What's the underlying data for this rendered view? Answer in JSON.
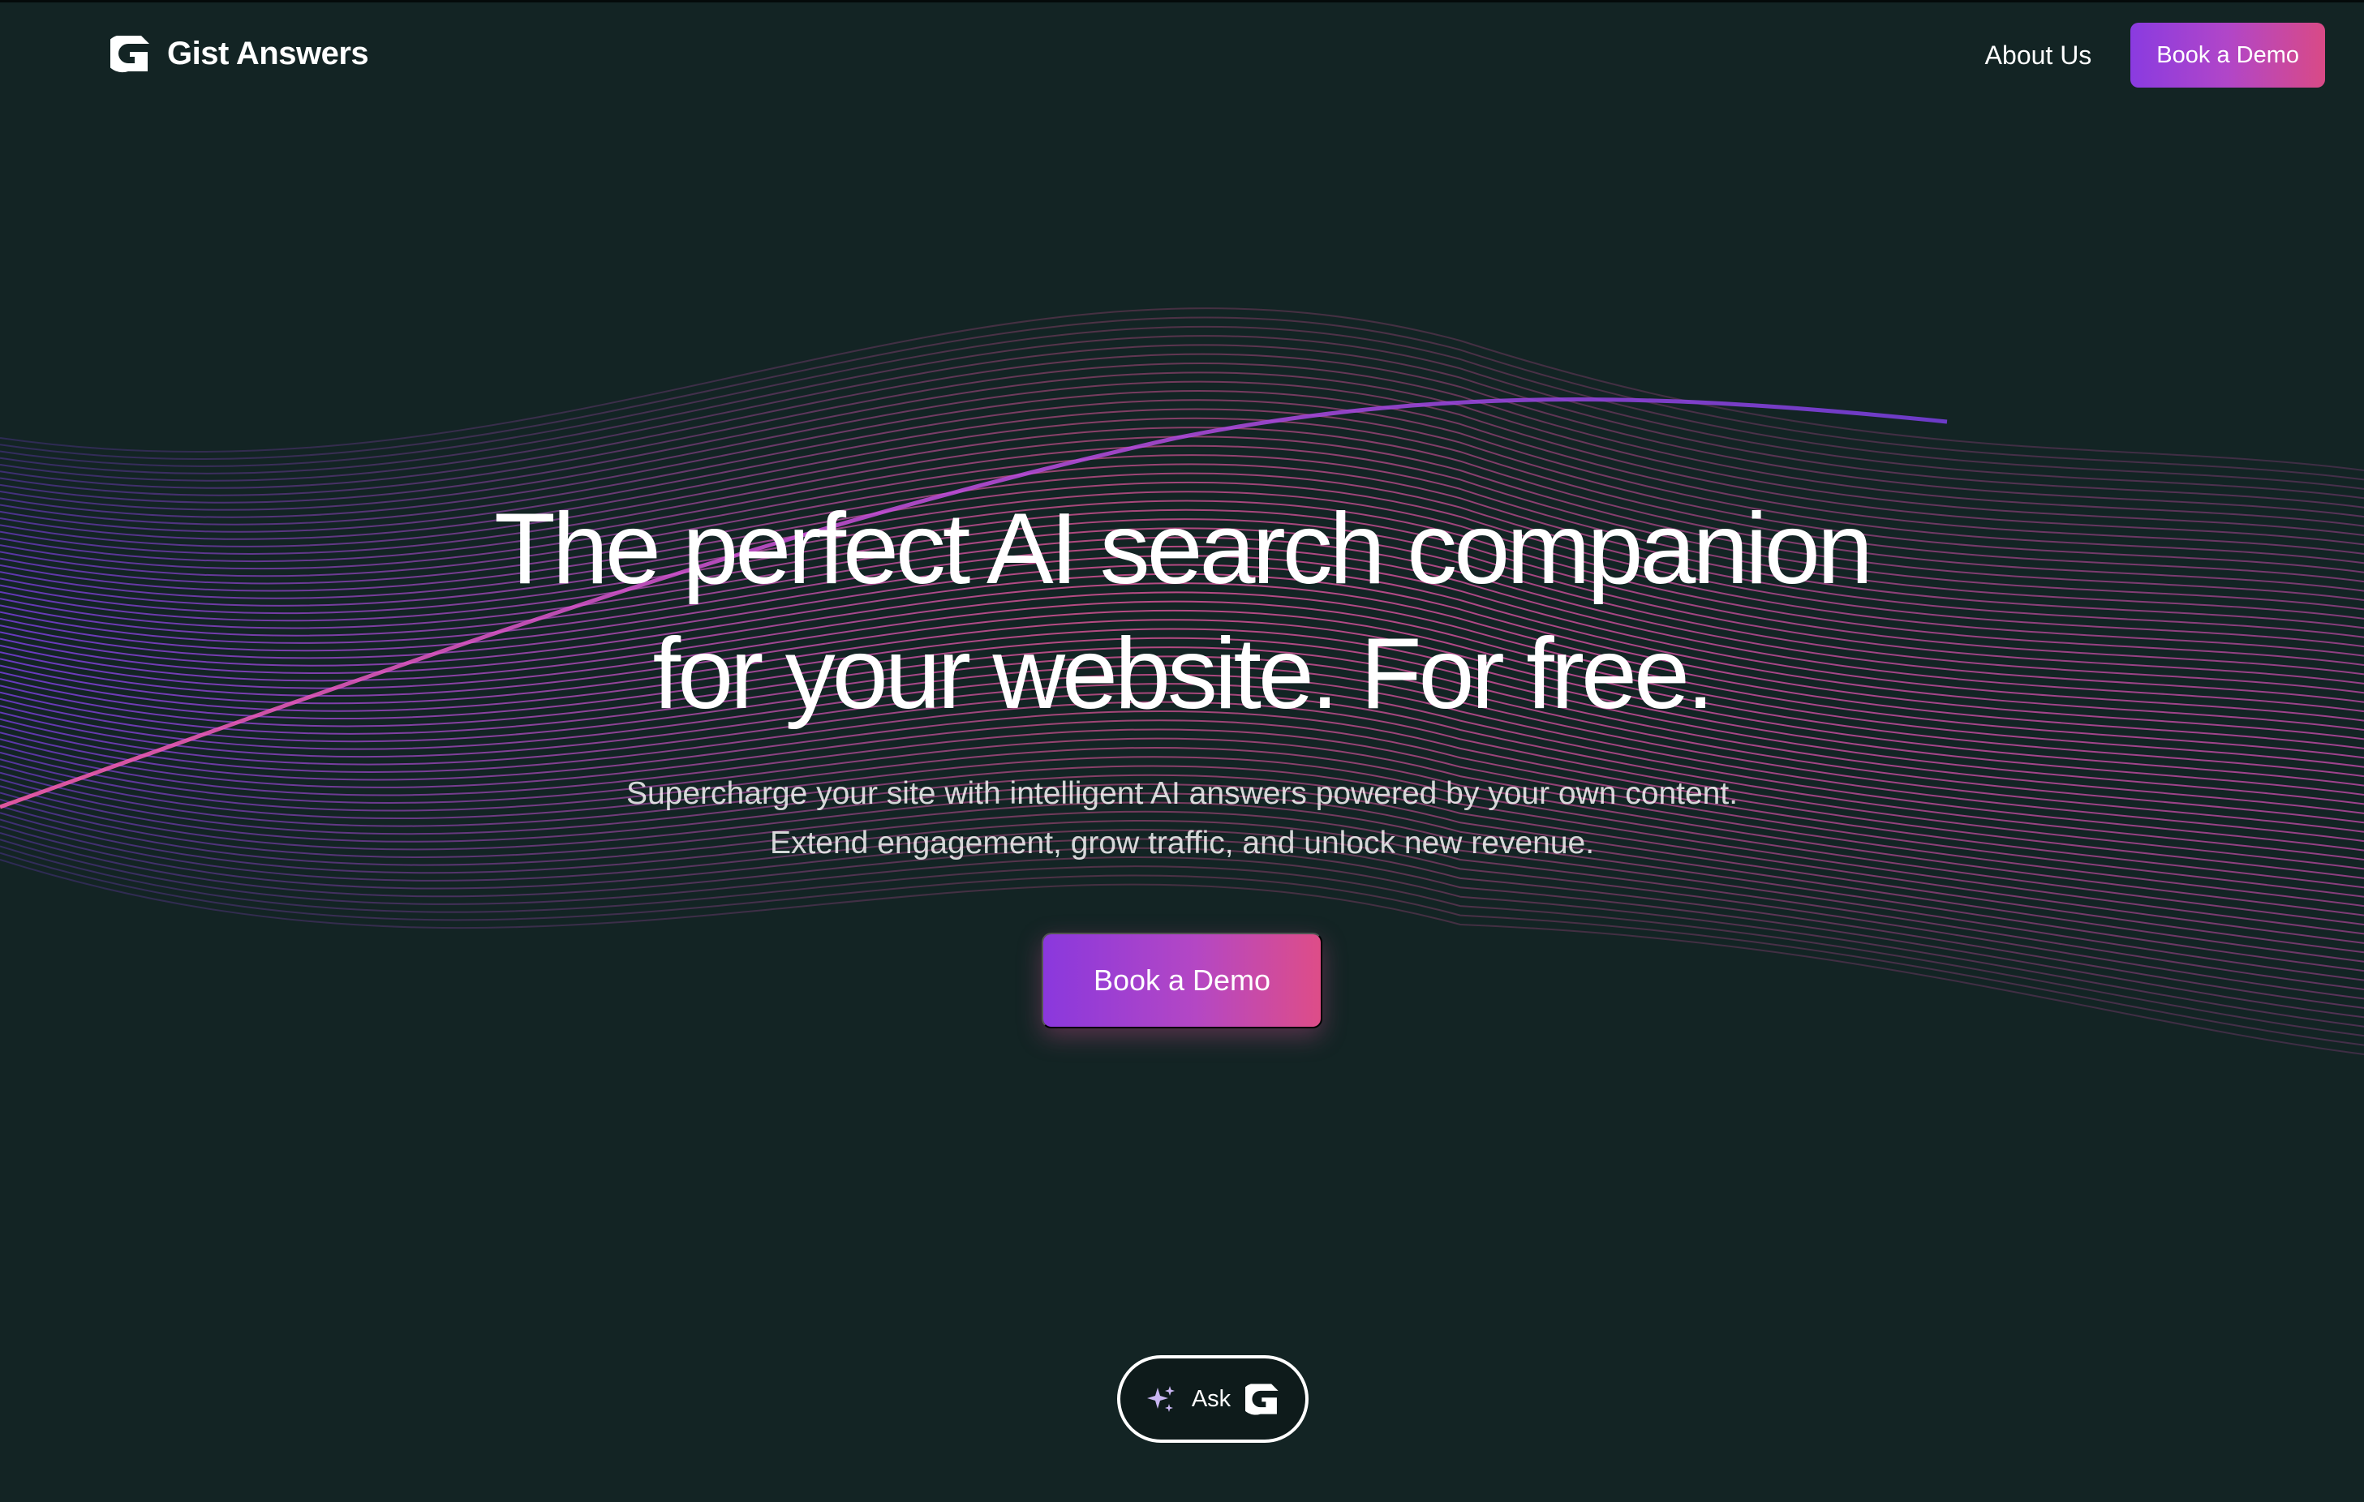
{
  "header": {
    "brand": "Gist Answers",
    "logo_icon": "gist-g-logo-icon",
    "nav": {
      "about_label": "About Us",
      "cta_label": "Book a Demo"
    }
  },
  "hero": {
    "title_line1": "The perfect AI search companion",
    "title_line2": "for your website. For free.",
    "subtitle_line1": "Supercharge your site with intelligent AI answers powered by your own content.",
    "subtitle_line2": "Extend engagement, grow traffic, and unlock new revenue.",
    "cta_label": "Book a Demo"
  },
  "ask_widget": {
    "label": "Ask",
    "sparkle_icon": "sparkle-icon",
    "logo_icon": "gist-g-logo-icon"
  },
  "colors": {
    "background": "#132424",
    "cta_gradient_start": "#8a3be0",
    "cta_gradient_end": "#d94a86",
    "wave_purple": "#7b3fe4",
    "wave_pink": "#e0559a"
  }
}
